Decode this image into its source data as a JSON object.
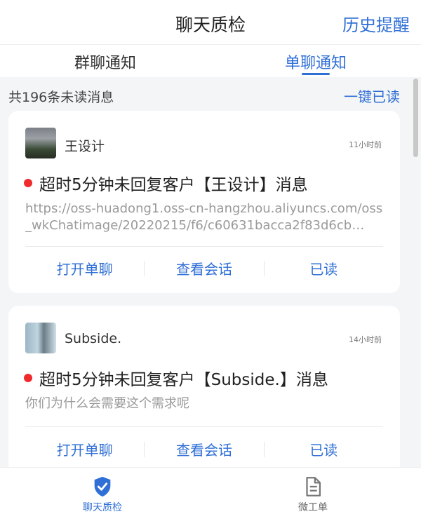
{
  "header": {
    "title": "聊天质检",
    "history_label": "历史提醒"
  },
  "tabs": [
    {
      "label": "群聊通知",
      "active": false
    },
    {
      "label": "单聊通知",
      "active": true
    }
  ],
  "summary": {
    "unread_text": "共196条未读消息",
    "read_all_label": "一键已读"
  },
  "cards": [
    {
      "name": "王设计",
      "time": "11小时前",
      "alert_title": "超时5分钟未回复客户【王设计】消息",
      "message": "https://oss-huadong1.oss-cn-hangzhou.aliyuncs.com/oss_wkChatimage/20220215/f6/c60631bacca2f83d6cb…",
      "actions": [
        "打开单聊",
        "查看会话",
        "已读"
      ]
    },
    {
      "name": "Subside.",
      "time": "14小时前",
      "alert_title": "超时5分钟未回复客户【Subside.】消息",
      "message": "你们为什么会需要这个需求呢",
      "actions": [
        "打开单聊",
        "查看会话",
        "已读"
      ]
    }
  ],
  "bottom_nav": [
    {
      "label": "聊天质检",
      "icon": "shield-check-icon",
      "active": true
    },
    {
      "label": "微工单",
      "icon": "document-icon",
      "active": false
    }
  ],
  "colors": {
    "accent": "#2f6fd6",
    "alert_dot": "#f02b2b",
    "background": "#f4f5f7"
  }
}
